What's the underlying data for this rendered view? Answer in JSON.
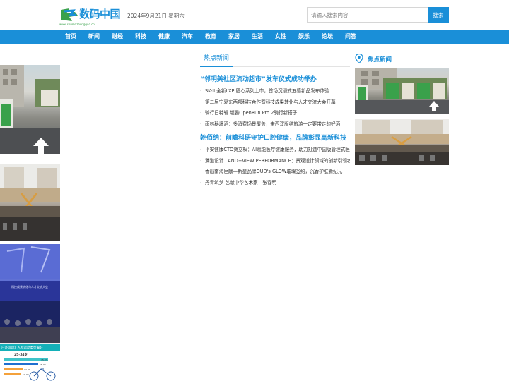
{
  "header": {
    "logo_text": "数码中国",
    "logo_url": "www.shumazhongguo.cn",
    "date": "2024年9月21日 星期六",
    "search_placeholder": "请输入搜索内容",
    "search_button": "搜索"
  },
  "nav": {
    "items": [
      "首页",
      "新闻",
      "财经",
      "科技",
      "健康",
      "汽车",
      "教育",
      "家居",
      "生活",
      "女性",
      "娱乐",
      "论坛",
      "问答"
    ]
  },
  "hot_news": {
    "tab_label": "热点新闻",
    "headline_1": "“邻明美社区流动超市”发车仪式成功举办",
    "items_1": [
      "SK-II 全新LXP 匠心系列上市，首场沉浸式五感新品发布体验",
      "第二届宁夏东西部科技合作暨科技成果转化与人才交流大会开幕",
      "骑行日特辑 超霸OpenRun Pro 2骑行新搭子",
      "雨林秘境酒：多消费场景覆盖，来西双版纳旅游一定要带走的好酒"
    ],
    "headline_2": "乾佰纳：前瞻科研守护口腔健康，品牌彰显高新科技",
    "items_2": [
      "平安健康CTO贺立权：AI赋能医疗健康服务，助力打造中国版管理式医疗",
      "澜道设计 LAND+VIEW PERFORMANCE：景观设计领域的创新引领者",
      "香出南海巨献—新星品牌OUD's GLOW璀璨签约，沉香护肤新纪元",
      "丹青筑梦 艺献中华艺术家—张春明"
    ]
  },
  "focus_news": {
    "title": "焦点新闻"
  },
  "ads": {
    "ad3_text_1": "科技成果转化与人才交流大会",
    "ad4_banner": "户外运动】人群运动类型偏好",
    "ad4_age": "25-34岁",
    "ad4_values": [
      "75.4%",
      "58.7%",
      "32.8%",
      "10.7%"
    ]
  },
  "colors": {
    "brand": "#1a8fd8",
    "logo_green": "#3aa14b"
  }
}
